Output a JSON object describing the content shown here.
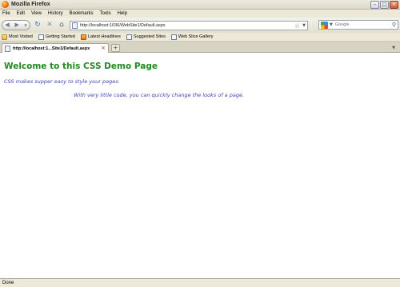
{
  "window": {
    "title": "Mozilla Firefox"
  },
  "menu": [
    "File",
    "Edit",
    "View",
    "History",
    "Bookmarks",
    "Tools",
    "Help"
  ],
  "nav": {
    "url": "http://localhost:1036/WebSite1/Default.aspx",
    "search_placeholder": "Google"
  },
  "bookmarks": [
    {
      "label": "Most Visited",
      "icon": "folder"
    },
    {
      "label": "Getting Started",
      "icon": "page"
    },
    {
      "label": "Latest Headlines",
      "icon": "rss"
    },
    {
      "label": "Suggested Sites",
      "icon": "page"
    },
    {
      "label": "Web Slice Gallery",
      "icon": "page"
    }
  ],
  "tab": {
    "label": "http://localhost:1...Site1/Default.aspx"
  },
  "content": {
    "title": "Welcome to this CSS Demo Page",
    "intro": "CSS makes supper easy to style your pages.",
    "indented": "With very little code, you can quickly change the looks of a page."
  },
  "status": {
    "text": "Done"
  },
  "colors": {
    "title_green": "#1f8a1f",
    "body_blue": "#4040c0"
  }
}
